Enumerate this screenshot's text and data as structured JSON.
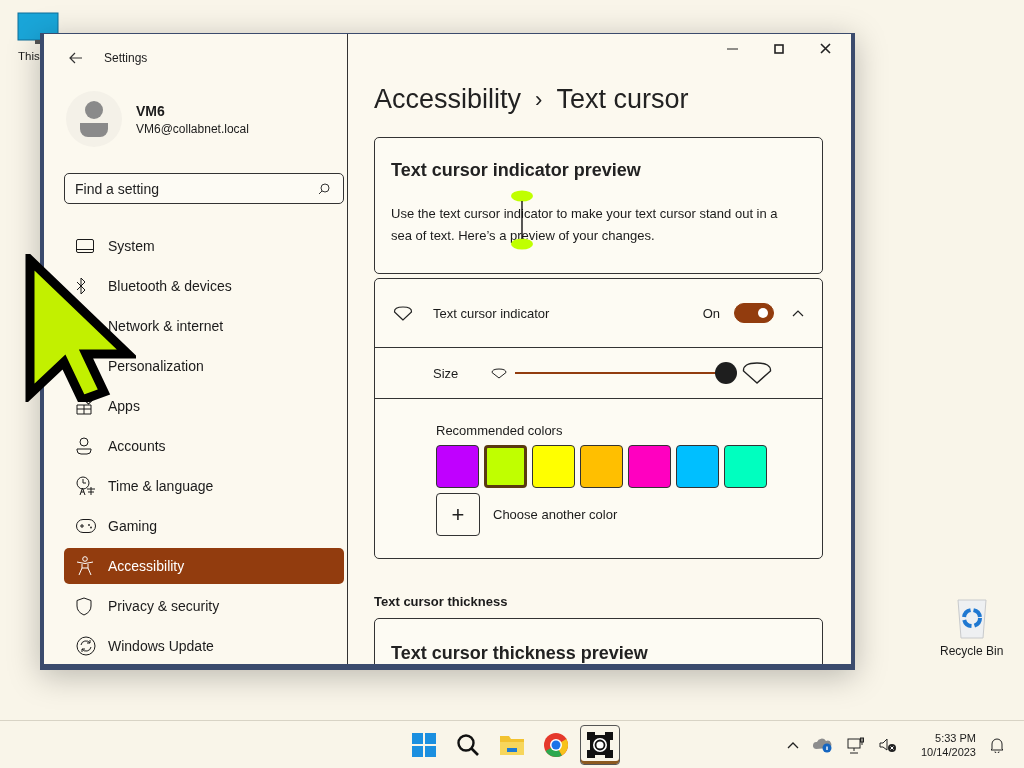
{
  "desktop_icons": [
    {
      "label": "This"
    },
    {
      "label": "Recycle Bin"
    }
  ],
  "window": {
    "title": "Settings"
  },
  "account": {
    "name": "VM6",
    "email": "VM6@collabnet.local"
  },
  "search": {
    "placeholder": "Find a setting"
  },
  "sidebar": {
    "items": [
      {
        "label": "System",
        "selected": false
      },
      {
        "label": "Bluetooth & devices",
        "selected": false
      },
      {
        "label": "Network & internet",
        "selected": false
      },
      {
        "label": "Personalization",
        "selected": false
      },
      {
        "label": "Apps",
        "selected": false
      },
      {
        "label": "Accounts",
        "selected": false
      },
      {
        "label": "Time & language",
        "selected": false
      },
      {
        "label": "Gaming",
        "selected": false
      },
      {
        "label": "Accessibility",
        "selected": true
      },
      {
        "label": "Privacy & security",
        "selected": false
      },
      {
        "label": "Windows Update",
        "selected": false
      }
    ]
  },
  "breadcrumb": {
    "parent": "Accessibility",
    "separator": "›",
    "current": "Text cursor"
  },
  "preview_card": {
    "title": "Text cursor indicator preview",
    "text": "Use the text cursor indicator to make your text cursor stand out in a sea of text. Here’s a preview of your changes."
  },
  "indicator": {
    "label": "Text cursor indicator",
    "on": true,
    "state_text": "On",
    "expanded": true,
    "size": {
      "label": "Size",
      "level": 1.0
    },
    "colors_label": "Recommended colors",
    "colors": [
      {
        "color": "#c000ff",
        "selected": false
      },
      {
        "color": "#c0ff00",
        "selected": true
      },
      {
        "color": "#ffff00",
        "selected": false
      },
      {
        "color": "#ffbf00",
        "selected": false
      },
      {
        "color": "#ff00c0",
        "selected": false
      },
      {
        "color": "#00bfff",
        "selected": false
      },
      {
        "color": "#00ffbf",
        "selected": false
      }
    ],
    "custom_color": {
      "button": "+",
      "label": "Choose another color"
    }
  },
  "thickness": {
    "heading": "Text cursor thickness",
    "preview_title": "Text cursor thickness preview"
  },
  "taskbar": {
    "apps": [
      {
        "selected": false
      },
      {
        "selected": false
      },
      {
        "selected": false
      },
      {
        "selected": false
      },
      {
        "selected": true
      }
    ],
    "time": "5:33 PM",
    "date": "10/14/2023"
  }
}
